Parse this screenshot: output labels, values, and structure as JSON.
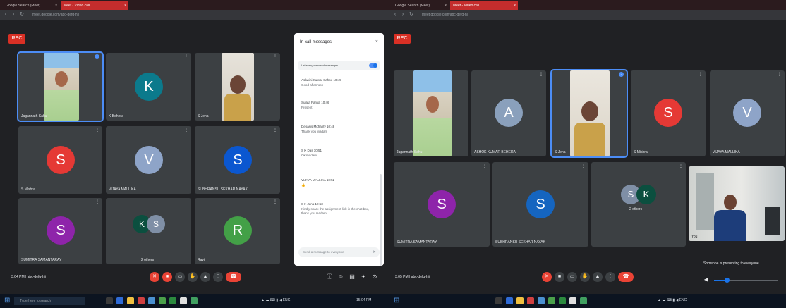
{
  "colors": {
    "k": "#0b7a8c",
    "s_red": "#e53935",
    "v": "#8ea4c8",
    "s_blue": "#0b57d0",
    "s_purple": "#8e24aa",
    "k_dark": "#0b4f3f",
    "s_gray": "#7f8fa6",
    "r": "#43a047",
    "a": "#8aa0bc",
    "s_navy": "#1565c0"
  },
  "left": {
    "tabs": [
      {
        "label": "Google Search (Meet)"
      },
      {
        "label": "Meet - Video call"
      }
    ],
    "url": "meet.google.com/abc-defg-hij",
    "rec_badge": "REC",
    "tiles": [
      {
        "name": "Jagannath Sahu",
        "kind": "video"
      },
      {
        "name": "K Behera",
        "kind": "avatar",
        "letter": "K",
        "color": "k"
      },
      {
        "name": "S Jena",
        "kind": "video"
      },
      {
        "name": "S Mishra",
        "kind": "avatar",
        "letter": "S",
        "color": "s_red"
      },
      {
        "name": "VIJAYA MALLIKA",
        "kind": "avatar",
        "letter": "V",
        "color": "v"
      },
      {
        "name": "SUBHRANSU SEKHAR NAYAK",
        "kind": "avatar",
        "letter": "S",
        "color": "s_blue"
      },
      {
        "name": "SUMITRA SAMANTARAY",
        "kind": "avatar",
        "letter": "S",
        "color": "s_purple"
      },
      {
        "name": "2 others",
        "kind": "group",
        "letters": [
          "K",
          "S"
        ],
        "colors": [
          "k_dark",
          "s_gray"
        ]
      },
      {
        "name": "Ravi",
        "kind": "avatar",
        "letter": "R",
        "color": "r"
      }
    ],
    "chat": {
      "title": "In-call messages",
      "toggle_label": "Let everyone send messages",
      "messages": [
        {
          "head": "Ashwini Kumar Sahoo 10:45",
          "text": "Good afternoon"
        },
        {
          "head": "Sujata Panda 10:46",
          "text": "Present"
        },
        {
          "head": "Debasis Mohanty 10:48",
          "text": "Thank you madam"
        },
        {
          "head": "S K Das 10:51",
          "text": "Ok madam"
        },
        {
          "head": "VIJAYA MALLIKA 10:52",
          "text": "👍"
        },
        {
          "head": "S K Jena 10:53",
          "text": "Kindly share the assignment link in the chat box, thank you madam"
        }
      ],
      "input_placeholder": "Send a message to everyone"
    },
    "meeting_info": "3:04 PM | abc-defg-hij"
  },
  "right": {
    "tabs": [
      {
        "label": "Google Search (Meet)"
      },
      {
        "label": "Meet - Video call"
      }
    ],
    "url": "meet.google.com/abc-defg-hij",
    "rec_badge": "REC",
    "tiles": [
      {
        "name": "Jagannath Sahu",
        "kind": "video"
      },
      {
        "name": "ASHOK KUMAR BEHERA",
        "kind": "avatar",
        "letter": "A",
        "color": "a"
      },
      {
        "name": "S Jena",
        "kind": "video"
      },
      {
        "name": "S Mishra",
        "kind": "avatar",
        "letter": "S",
        "color": "s_red"
      },
      {
        "name": "VIJAYA MALLIKA",
        "kind": "avatar",
        "letter": "V",
        "color": "v"
      },
      {
        "name": "SUMITRA SAMANTARAY",
        "kind": "avatar",
        "letter": "S",
        "color": "s_purple"
      },
      {
        "name": "SUBHRANSU SEKHAR NAYAK",
        "kind": "avatar",
        "letter": "S",
        "color": "s_navy"
      },
      {
        "name": "2 others",
        "kind": "group",
        "letters": [
          "S",
          "K"
        ],
        "colors": [
          "s_gray",
          "k_dark"
        ]
      },
      {
        "name": "You",
        "kind": "video"
      }
    ],
    "presenting_label": "Someone is presenting to everyone",
    "meeting_info": "3:05 PM | abc-defg-hij",
    "volume_level": 0.2
  },
  "taskbar": {
    "search_placeholder": "Type here to search",
    "tray_time": "15:04 PM"
  }
}
